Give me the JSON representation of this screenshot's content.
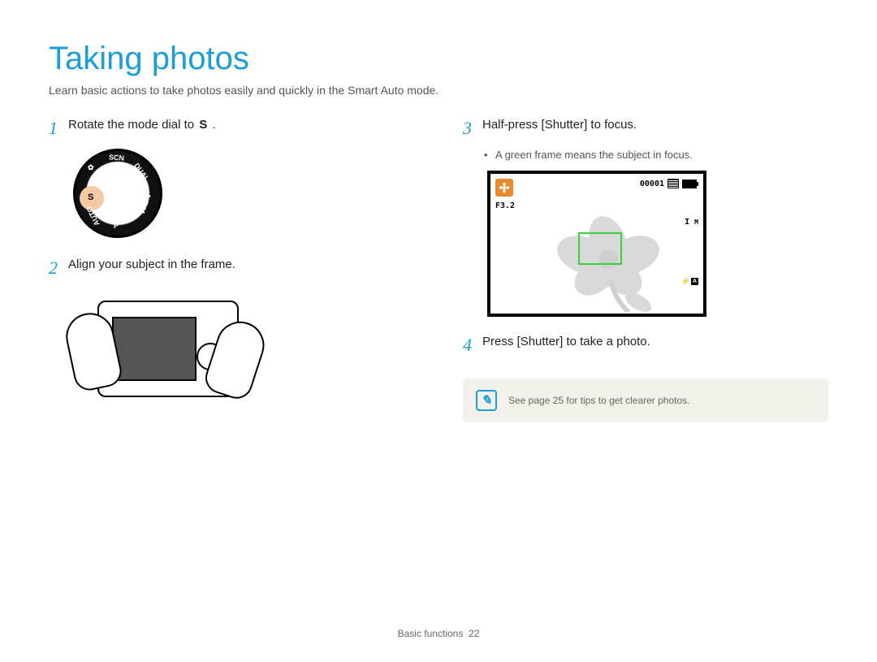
{
  "page": {
    "title": "Taking photos",
    "intro": "Learn basic actions to take photos easily and quickly in the Smart Auto mode."
  },
  "steps": {
    "s1": {
      "num": "1",
      "text_a": "Rotate the mode dial to",
      "text_b": "S",
      "text_c": "."
    },
    "s2": {
      "num": "2",
      "text": "Align your subject in the frame."
    },
    "s3": {
      "num": "3",
      "text_a": "Half-press [",
      "text_b": "Shutter",
      "text_c": "] to focus."
    },
    "s3_sub": "A green frame means the subject in focus.",
    "s4": {
      "num": "4",
      "text_a": "Press [",
      "text_b": "Shutter",
      "text_c": "] to take a photo."
    }
  },
  "viewfinder": {
    "f_value": "F3.2",
    "counter": "00001",
    "mode_indicator": "I",
    "size_indicator": "M"
  },
  "tip": {
    "text": "See page 25 for tips to get clearer photos."
  },
  "footer": {
    "section": "Basic functions",
    "page": "22"
  },
  "mode_dial_labels": [
    "SCN",
    "DUAL",
    "A·S·M",
    "P",
    "AUTO",
    "S"
  ]
}
